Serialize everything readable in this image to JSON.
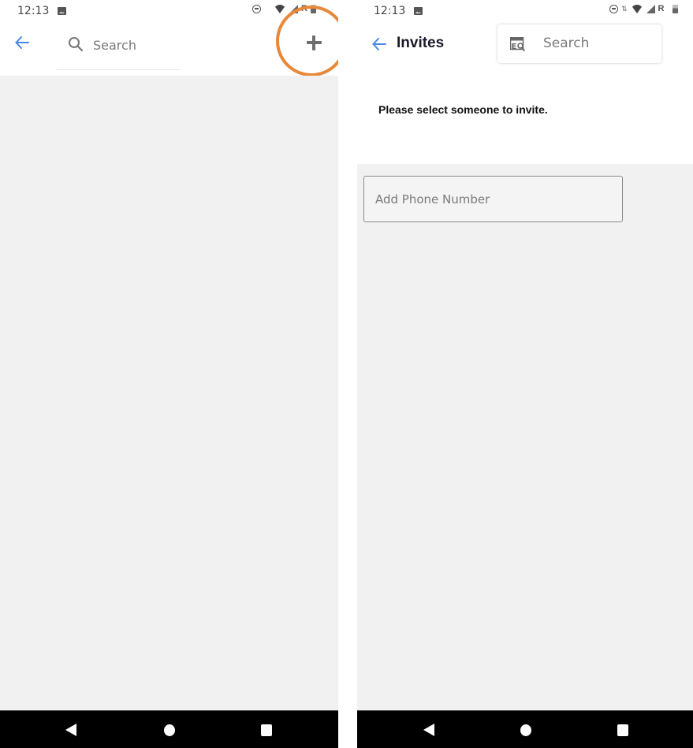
{
  "screens": {
    "left": {
      "status_bar": {
        "time": "12:13",
        "icons": [
          "image-notification-icon",
          "dnd-icon",
          "wifi-icon",
          "signal-icon",
          "roaming-r-icon",
          "battery-icon"
        ],
        "roaming_label": "R"
      },
      "header": {
        "back_icon": "arrow-left",
        "search_placeholder": "Search",
        "add_icon": "plus"
      },
      "highlight_color": "#e8883a",
      "nav_bar": {
        "buttons": [
          "back",
          "home",
          "recents"
        ]
      }
    },
    "right": {
      "status_bar": {
        "time": "12:13",
        "icons": [
          "image-notification-icon",
          "dnd-icon",
          "data-activity-icon",
          "wifi-icon",
          "signal-icon",
          "roaming-r-icon",
          "battery-icon"
        ],
        "roaming_label": "R",
        "data_activity_glyph": "⇅"
      },
      "header": {
        "back_icon": "arrow-left",
        "title": "Invites",
        "search_placeholder": "Search"
      },
      "prompt": "Please select someone to invite.",
      "phone_input": {
        "placeholder": "Add Phone Number",
        "value": ""
      },
      "nav_bar": {
        "buttons": [
          "back",
          "home",
          "recents"
        ]
      }
    }
  },
  "colors": {
    "accent": "#4a86e8",
    "background_gray": "#f1f1f1",
    "highlight": "#e8883a"
  }
}
